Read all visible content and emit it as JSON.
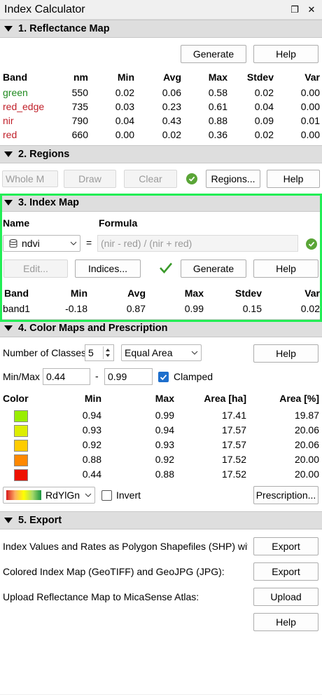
{
  "window": {
    "title": "Index Calculator",
    "float_icon": "❐",
    "close_icon": "✕"
  },
  "s1": {
    "header": "1. Reflectance Map",
    "generate": "Generate",
    "help": "Help",
    "columns": [
      "Band",
      "nm",
      "Min",
      "Avg",
      "Max",
      "Stdev",
      "Var"
    ],
    "rows": [
      {
        "band": "green",
        "color": "#1f8a1f",
        "nm": "550",
        "min": "0.02",
        "avg": "0.06",
        "max": "0.58",
        "stdev": "0.02",
        "var": "0.00"
      },
      {
        "band": "red_edge",
        "color": "#c0202a",
        "nm": "735",
        "min": "0.03",
        "avg": "0.23",
        "max": "0.61",
        "stdev": "0.04",
        "var": "0.00"
      },
      {
        "band": "nir",
        "color": "#c0202a",
        "nm": "790",
        "min": "0.04",
        "avg": "0.43",
        "max": "0.88",
        "stdev": "0.09",
        "var": "0.01"
      },
      {
        "band": "red",
        "color": "#c0202a",
        "nm": "660",
        "min": "0.00",
        "avg": "0.02",
        "max": "0.36",
        "stdev": "0.02",
        "var": "0.00"
      }
    ]
  },
  "s2": {
    "header": "2. Regions",
    "region_select": "Whole M",
    "draw": "Draw",
    "clear": "Clear",
    "regions": "Regions...",
    "help": "Help"
  },
  "s3": {
    "header": "3. Index Map",
    "name_label": "Name",
    "formula_label": "Formula",
    "index_name": "ndvi",
    "equals": "=",
    "formula": "(nir - red) / (nir + red)",
    "edit": "Edit...",
    "indices": "Indices...",
    "generate": "Generate",
    "help": "Help",
    "columns": [
      "Band",
      "Min",
      "Avg",
      "Max",
      "Stdev",
      "Var"
    ],
    "row": {
      "band": "band1",
      "min": "-0.18",
      "avg": "0.87",
      "max": "0.99",
      "stdev": "0.15",
      "var": "0.02"
    }
  },
  "s4": {
    "header": "4. Color Maps and Prescription",
    "classes_label": "Number of Classes",
    "classes_value": "5",
    "method": "Equal Area",
    "help": "Help",
    "minmax_label": "Min/Max",
    "min_value": "0.44",
    "dash": "-",
    "max_value": "0.99",
    "clamped": "Clamped",
    "columns": [
      "Color",
      "Min",
      "Max",
      "Area [ha]",
      "Area [%]"
    ],
    "rows": [
      {
        "color": "#99ee00",
        "min": "0.94",
        "max": "0.99",
        "ha": "17.41",
        "pct": "19.87"
      },
      {
        "color": "#ddee00",
        "min": "0.93",
        "max": "0.94",
        "ha": "17.57",
        "pct": "20.06"
      },
      {
        "color": "#ffcc00",
        "min": "0.92",
        "max": "0.93",
        "ha": "17.57",
        "pct": "20.06"
      },
      {
        "color": "#ff8800",
        "min": "0.88",
        "max": "0.92",
        "ha": "17.52",
        "pct": "20.00"
      },
      {
        "color": "#ee1100",
        "min": "0.44",
        "max": "0.88",
        "ha": "17.52",
        "pct": "20.00"
      }
    ],
    "colormap": "RdYlGn",
    "invert": "Invert",
    "prescription": "Prescription..."
  },
  "s5": {
    "header": "5. Export",
    "rows": [
      {
        "label": "Index Values and Rates as Polygon Shapefiles (SHP) with C",
        "button": "Export"
      },
      {
        "label": "Colored Index Map (GeoTIFF) and GeoJPG (JPG):",
        "button": "Export"
      },
      {
        "label": "Upload Reflectance Map to MicaSense Atlas:",
        "button": "Upload"
      }
    ],
    "help": "Help"
  }
}
